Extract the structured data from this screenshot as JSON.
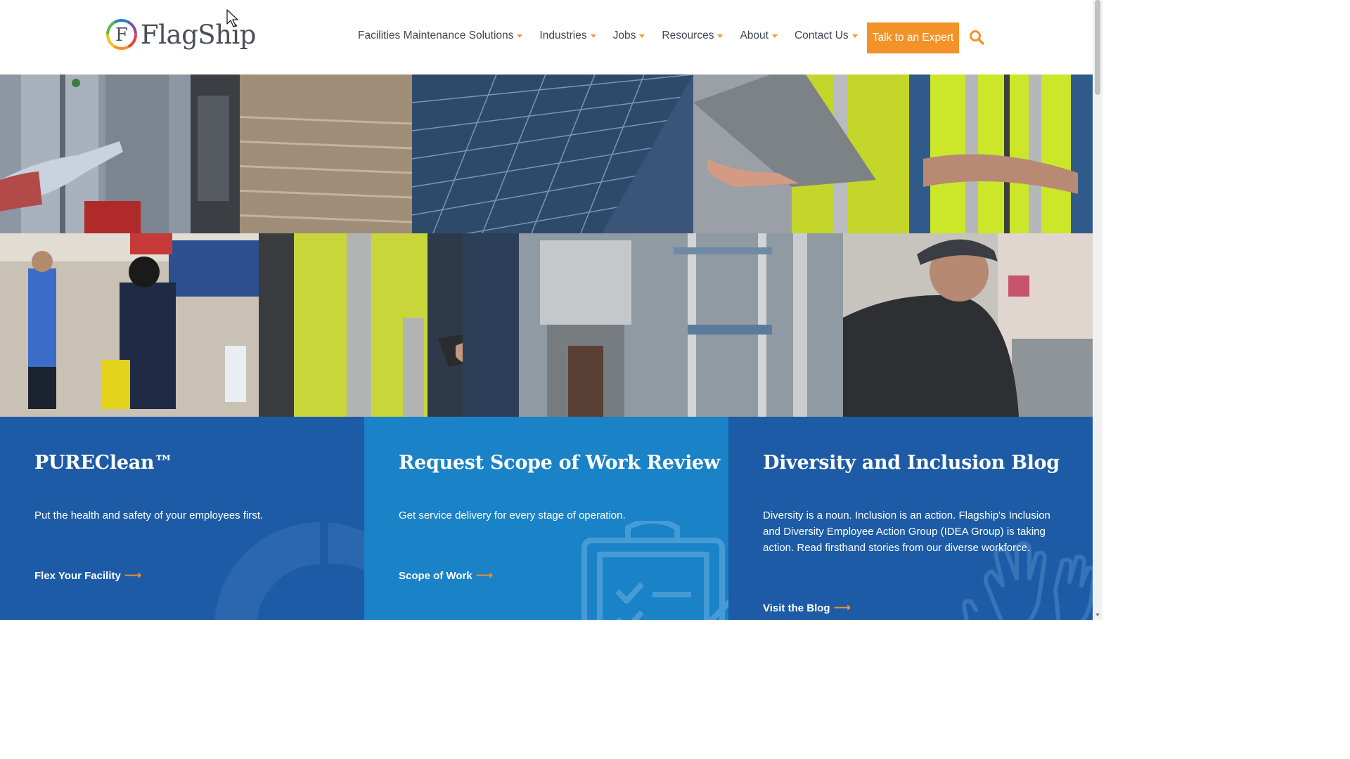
{
  "header": {
    "logo_text": "FlagShip",
    "nav": [
      {
        "label": "Facilities Maintenance Solutions"
      },
      {
        "label": "Industries"
      },
      {
        "label": "Jobs"
      },
      {
        "label": "Resources"
      },
      {
        "label": "About"
      },
      {
        "label": "Contact Us"
      }
    ],
    "cta_label": "Talk to an Expert",
    "search_icon": "search-icon"
  },
  "cards": [
    {
      "title": "PUREClean™",
      "text": "Put the health and safety of your employees first.",
      "link": "Flex Your Facility",
      "arrow": "⟶"
    },
    {
      "title": "Request Scope of Work Review",
      "text": "Get service delivery for every stage of operation.",
      "link": "Scope of Work",
      "arrow": "⟶"
    },
    {
      "title": "Diversity and Inclusion Blog",
      "text": "Diversity is a noun. Inclusion is an action. Flagship's Inclusion and Diversity Employee Action Group (IDEA Group) is taking action. Read firsthand stories from our diverse workforce.",
      "link": "Visit the Blog",
      "arrow": "⟶"
    }
  ],
  "colors": {
    "accent": "#f39228",
    "card_dark": "#1d5ba6",
    "card_light": "#1a82c6",
    "nav_text": "#3f4650"
  }
}
